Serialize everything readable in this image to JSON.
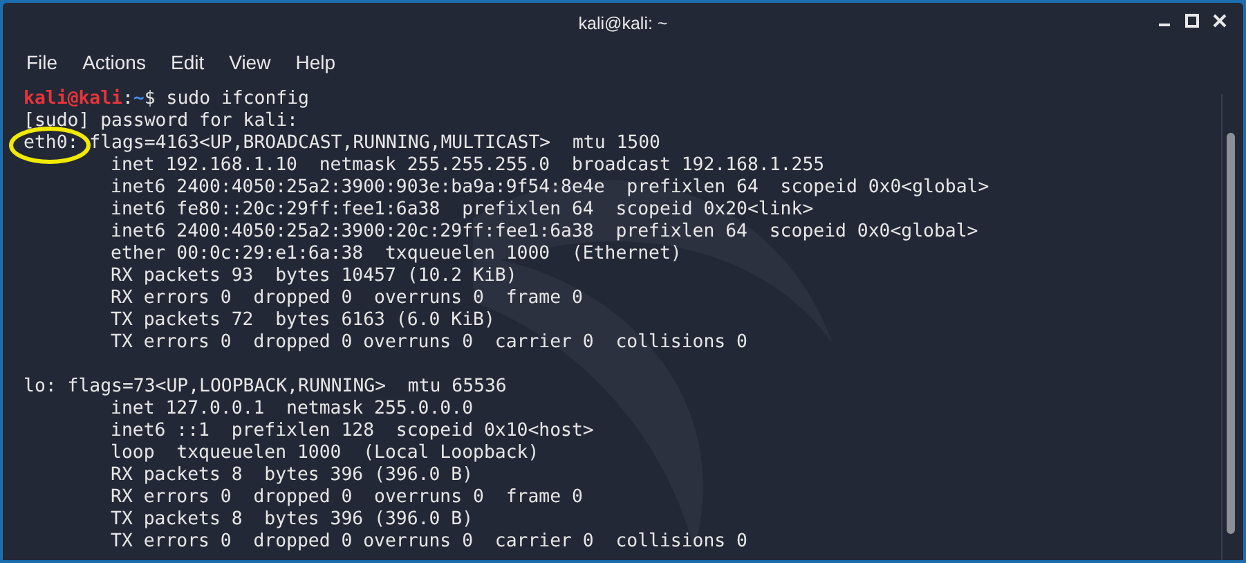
{
  "window": {
    "title": "kali@kali: ~"
  },
  "menu": [
    "File",
    "Actions",
    "Edit",
    "View",
    "Help"
  ],
  "terminal": {
    "prompt": {
      "user_host": "kali@kali",
      "separator": ":",
      "path": "~",
      "symbol": "$",
      "command": "sudo ifconfig"
    },
    "sudo_line": "[sudo] password for kali:",
    "interfaces": [
      {
        "name": "eth0:",
        "highlighted": true,
        "header": "flags=4163<UP,BROADCAST,RUNNING,MULTICAST>  mtu 1500",
        "details": [
          "inet 192.168.1.10  netmask 255.255.255.0  broadcast 192.168.1.255",
          "inet6 2400:4050:25a2:3900:903e:ba9a:9f54:8e4e  prefixlen 64  scopeid 0x0<global>",
          "inet6 fe80::20c:29ff:fee1:6a38  prefixlen 64  scopeid 0x20<link>",
          "inet6 2400:4050:25a2:3900:20c:29ff:fee1:6a38  prefixlen 64  scopeid 0x0<global>",
          "ether 00:0c:29:e1:6a:38  txqueuelen 1000  (Ethernet)",
          "RX packets 93  bytes 10457 (10.2 KiB)",
          "RX errors 0  dropped 0  overruns 0  frame 0",
          "TX packets 72  bytes 6163 (6.0 KiB)",
          "TX errors 0  dropped 0 overruns 0  carrier 0  collisions 0"
        ]
      },
      {
        "name": "lo:",
        "highlighted": false,
        "header": "flags=73<UP,LOOPBACK,RUNNING>  mtu 65536",
        "details": [
          "inet 127.0.0.1  netmask 255.0.0.0",
          "inet6 ::1  prefixlen 128  scopeid 0x10<host>",
          "loop  txqueuelen 1000  (Local Loopback)",
          "RX packets 8  bytes 396 (396.0 B)",
          "RX errors 0  dropped 0  overruns 0  frame 0",
          "TX packets 8  bytes 396 (396.0 B)",
          "TX errors 0  dropped 0 overruns 0  carrier 0  collisions 0"
        ]
      }
    ]
  }
}
